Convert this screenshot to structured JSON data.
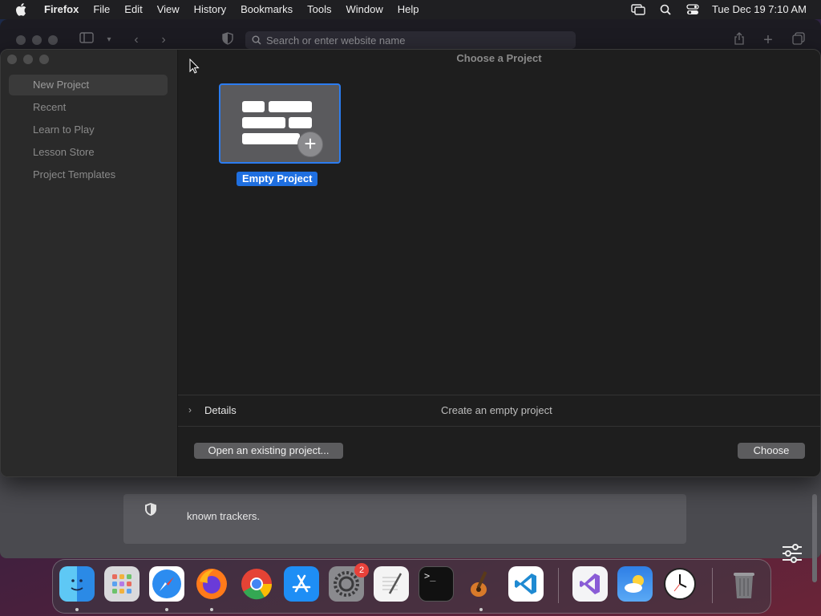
{
  "menubar": {
    "app_name": "Firefox",
    "menus": [
      "File",
      "Edit",
      "View",
      "History",
      "Bookmarks",
      "Tools",
      "Window",
      "Help"
    ],
    "clock": "Tue Dec 19  7:10 AM"
  },
  "browser": {
    "url_placeholder": "Search or enter website name",
    "tracker_text": "known trackers."
  },
  "dialog": {
    "title": "Choose a Project",
    "sidebar": [
      "New Project",
      "Recent",
      "Learn to Play",
      "Lesson Store",
      "Project Templates"
    ],
    "selected_sidebar": "New Project",
    "template_label": "Empty Project",
    "details_label": "Details",
    "details_description": "Create an empty project",
    "open_existing_label": "Open an existing project...",
    "choose_label": "Choose"
  },
  "dock": {
    "apps": [
      "Finder",
      "Launchpad",
      "Safari",
      "Firefox",
      "Chrome",
      "App Store",
      "System Preferences",
      "TextEdit",
      "Terminal",
      "GarageBand",
      "Visual Studio Code",
      "Visual Studio",
      "Weather",
      "Clock",
      "Trash"
    ],
    "system_preferences_badge": "2"
  },
  "colors": {
    "accent": "#1f6fe0",
    "dialog_bg": "#1e1e1e",
    "sidebar_bg": "#2a2a2a"
  }
}
